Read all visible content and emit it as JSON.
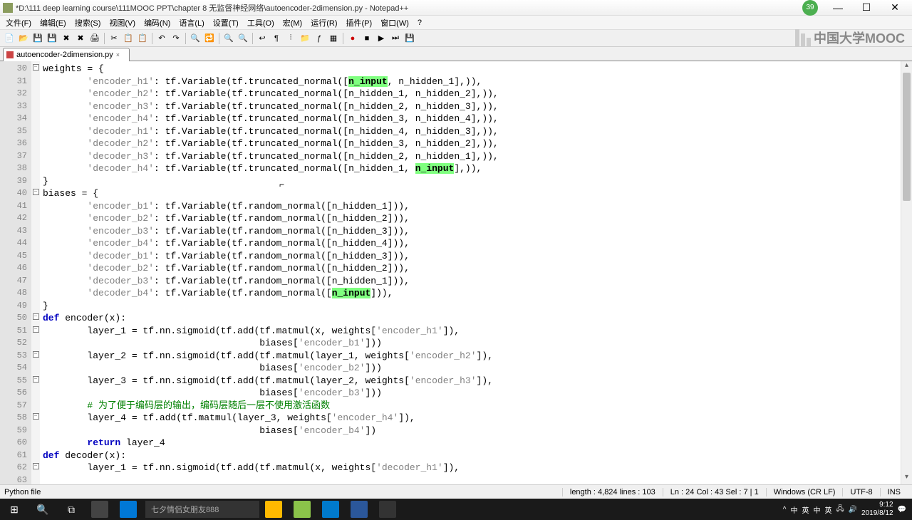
{
  "title": "*D:\\111 deep learning course\\111MOOC PPT\\chapter 8 无监督神经网络\\autoencoder-2dimension.py - Notepad++",
  "badge": "39",
  "menus": [
    "文件(F)",
    "编辑(E)",
    "搜索(S)",
    "视图(V)",
    "编码(N)",
    "语言(L)",
    "设置(T)",
    "工具(O)",
    "宏(M)",
    "运行(R)",
    "插件(P)",
    "窗口(W)",
    "?"
  ],
  "tab": {
    "name": "autoencoder-2dimension.py",
    "close": "×"
  },
  "mooc": "中国大学MOOC",
  "gutter_start": 30,
  "gutter_count": 34,
  "code_lines": [
    [
      [
        "",
        "weights = {"
      ]
    ],
    [
      [
        "",
        "        "
      ],
      [
        "str",
        "'encoder_h1'"
      ],
      [
        "",
        ": tf.Variable(tf.truncated_normal(["
      ],
      [
        "hl",
        "n_input"
      ],
      [
        "",
        ", n_hidden_1],)),"
      ]
    ],
    [
      [
        "",
        "        "
      ],
      [
        "str",
        "'encoder_h2'"
      ],
      [
        "",
        ": tf.Variable(tf.truncated_normal([n_hidden_1, n_hidden_2],)),"
      ]
    ],
    [
      [
        "",
        "        "
      ],
      [
        "str",
        "'encoder_h3'"
      ],
      [
        "",
        ": tf.Variable(tf.truncated_normal([n_hidden_2, n_hidden_3],)),"
      ]
    ],
    [
      [
        "",
        "        "
      ],
      [
        "str",
        "'encoder_h4'"
      ],
      [
        "",
        ": tf.Variable(tf.truncated_normal([n_hidden_3, n_hidden_4],)),"
      ]
    ],
    [
      [
        "",
        "        "
      ],
      [
        "str",
        "'decoder_h1'"
      ],
      [
        "",
        ": tf.Variable(tf.truncated_normal([n_hidden_4, n_hidden_3],)),"
      ]
    ],
    [
      [
        "",
        "        "
      ],
      [
        "str",
        "'decoder_h2'"
      ],
      [
        "",
        ": tf.Variable(tf.truncated_normal([n_hidden_3, n_hidden_2],)),"
      ]
    ],
    [
      [
        "",
        "        "
      ],
      [
        "str",
        "'decoder_h3'"
      ],
      [
        "",
        ": tf.Variable(tf.truncated_normal([n_hidden_2, n_hidden_1],)),"
      ]
    ],
    [
      [
        "",
        "        "
      ],
      [
        "str",
        "'decoder_h4'"
      ],
      [
        "",
        ": tf.Variable(tf.truncated_normal([n_hidden_1, "
      ],
      [
        "hl",
        "n_input"
      ],
      [
        "",
        "],)),"
      ]
    ],
    [
      [
        "",
        "}"
      ]
    ],
    [
      [
        "",
        "biases = {"
      ]
    ],
    [
      [
        "",
        "        "
      ],
      [
        "str",
        "'encoder_b1'"
      ],
      [
        "",
        ": tf.Variable(tf.random_normal([n_hidden_1])),"
      ]
    ],
    [
      [
        "",
        "        "
      ],
      [
        "str",
        "'encoder_b2'"
      ],
      [
        "",
        ": tf.Variable(tf.random_normal([n_hidden_2])),"
      ]
    ],
    [
      [
        "",
        "        "
      ],
      [
        "str",
        "'encoder_b3'"
      ],
      [
        "",
        ": tf.Variable(tf.random_normal([n_hidden_3])),"
      ]
    ],
    [
      [
        "",
        "        "
      ],
      [
        "str",
        "'encoder_b4'"
      ],
      [
        "",
        ": tf.Variable(tf.random_normal([n_hidden_4])),"
      ]
    ],
    [
      [
        "",
        "        "
      ],
      [
        "str",
        "'decoder_b1'"
      ],
      [
        "",
        ": tf.Variable(tf.random_normal([n_hidden_3])),"
      ]
    ],
    [
      [
        "",
        "        "
      ],
      [
        "str",
        "'decoder_b2'"
      ],
      [
        "",
        ": tf.Variable(tf.random_normal([n_hidden_2])),"
      ]
    ],
    [
      [
        "",
        "        "
      ],
      [
        "str",
        "'decoder_b3'"
      ],
      [
        "",
        ": tf.Variable(tf.random_normal([n_hidden_1])),"
      ]
    ],
    [
      [
        "",
        "        "
      ],
      [
        "str",
        "'decoder_b4'"
      ],
      [
        "",
        ": tf.Variable(tf.random_normal(["
      ],
      [
        "hl",
        "n_input"
      ],
      [
        "",
        "])),"
      ]
    ],
    [
      [
        "",
        "}"
      ]
    ],
    [
      [
        "kw",
        "def"
      ],
      [
        "",
        " "
      ],
      [
        "",
        "encoder"
      ],
      [
        "",
        "(x):"
      ]
    ],
    [
      [
        "",
        "        layer_1 = tf.nn.sigmoid(tf.add(tf.matmul(x, weights["
      ],
      [
        "str",
        "'encoder_h1'"
      ],
      [
        "",
        "]),"
      ]
    ],
    [
      [
        "",
        "                                       biases["
      ],
      [
        "str",
        "'encoder_b1'"
      ],
      [
        "",
        "]))"
      ]
    ],
    [
      [
        "",
        "        layer_2 = tf.nn.sigmoid(tf.add(tf.matmul(layer_1, weights["
      ],
      [
        "str",
        "'encoder_h2'"
      ],
      [
        "",
        "]),"
      ]
    ],
    [
      [
        "",
        "                                       biases["
      ],
      [
        "str",
        "'encoder_b2'"
      ],
      [
        "",
        "]))"
      ]
    ],
    [
      [
        "",
        "        layer_3 = tf.nn.sigmoid(tf.add(tf.matmul(layer_2, weights["
      ],
      [
        "str",
        "'encoder_h3'"
      ],
      [
        "",
        "]),"
      ]
    ],
    [
      [
        "",
        "                                       biases["
      ],
      [
        "str",
        "'encoder_b3'"
      ],
      [
        "",
        "]))"
      ]
    ],
    [
      [
        "comment",
        "        # 为了便于编码层的输出，编码层随后一层不使用激活函数"
      ]
    ],
    [
      [
        "",
        "        layer_4 = tf.add(tf.matmul(layer_3, weights["
      ],
      [
        "str",
        "'encoder_h4'"
      ],
      [
        "",
        "]),"
      ]
    ],
    [
      [
        "",
        "                                       biases["
      ],
      [
        "str",
        "'encoder_b4'"
      ],
      [
        "",
        "])"
      ]
    ],
    [
      [
        "",
        "        "
      ],
      [
        "kw",
        "return"
      ],
      [
        "",
        " layer_4"
      ]
    ],
    [
      [
        "",
        ""
      ]
    ],
    [
      [
        "kw",
        "def"
      ],
      [
        "",
        " "
      ],
      [
        "",
        "decoder"
      ],
      [
        "",
        "(x):"
      ]
    ],
    [
      [
        "",
        "        layer_1 = tf.nn.sigmoid(tf.add(tf.matmul(x, weights["
      ],
      [
        "str",
        "'decoder_h1'"
      ],
      [
        "",
        "]),"
      ]
    ]
  ],
  "fold_marks": {
    "0": "−",
    "10": "−",
    "20": "−",
    "21": "−",
    "23": "−",
    "25": "−",
    "28": "−",
    "32": "−"
  },
  "status": {
    "filetype": "Python file",
    "length": "length : 4,824    lines : 103",
    "pos": "Ln : 24    Col : 43    Sel : 7 | 1",
    "eol": "Windows (CR LF)",
    "enc": "UTF-8",
    "ins": "INS"
  },
  "tray": {
    "time": "9:12",
    "date": "2019/8/12",
    "ime": [
      "中",
      "英",
      "中",
      "英"
    ]
  },
  "cursor_text": "⌐"
}
